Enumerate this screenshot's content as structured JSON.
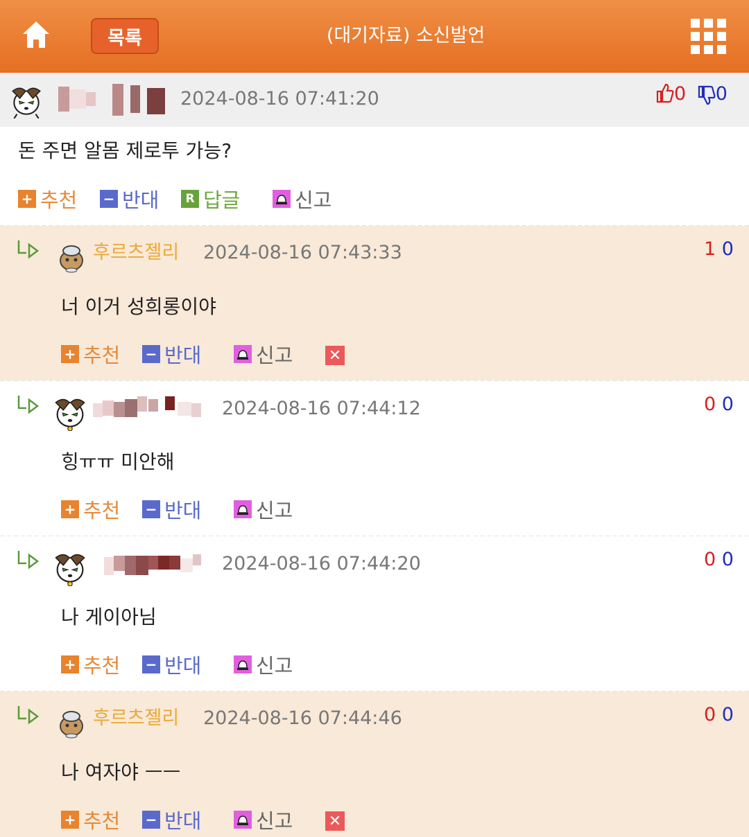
{
  "header": {
    "title": "(대기자료) 소신발언",
    "list_label": "목록"
  },
  "post": {
    "date": "2024-08-16 07:41:20",
    "body": "돈 주면 알몸 제로투 가능?",
    "likes": "0",
    "dislikes": "0",
    "actions": {
      "recommend": "추천",
      "oppose": "반대",
      "reply": "답글",
      "report": "신고"
    }
  },
  "comments": [
    {
      "author": "후르츠젤리",
      "date": "2024-08-16 07:43:33",
      "text": "너 이거 성희롱이야",
      "likes": "1",
      "dislikes": "0"
    },
    {
      "author": "",
      "date": "2024-08-16 07:44:12",
      "text": "힝ㅠㅠ 미안해",
      "likes": "0",
      "dislikes": "0"
    },
    {
      "author": "",
      "date": "2024-08-16 07:44:20",
      "text": "나 게이아님",
      "likes": "0",
      "dislikes": "0"
    },
    {
      "author": "후르츠젤리",
      "date": "2024-08-16 07:44:46",
      "text": "나 여자야 ㅡㅡ",
      "likes": "0",
      "dislikes": "0"
    }
  ],
  "comment_actions": {
    "recommend": "추천",
    "oppose": "반대",
    "report": "신고"
  },
  "colors": {
    "header": "#e8772c",
    "highlight_row": "#f8e9d8",
    "up": "#d51f1f",
    "down": "#1e2dbc"
  }
}
